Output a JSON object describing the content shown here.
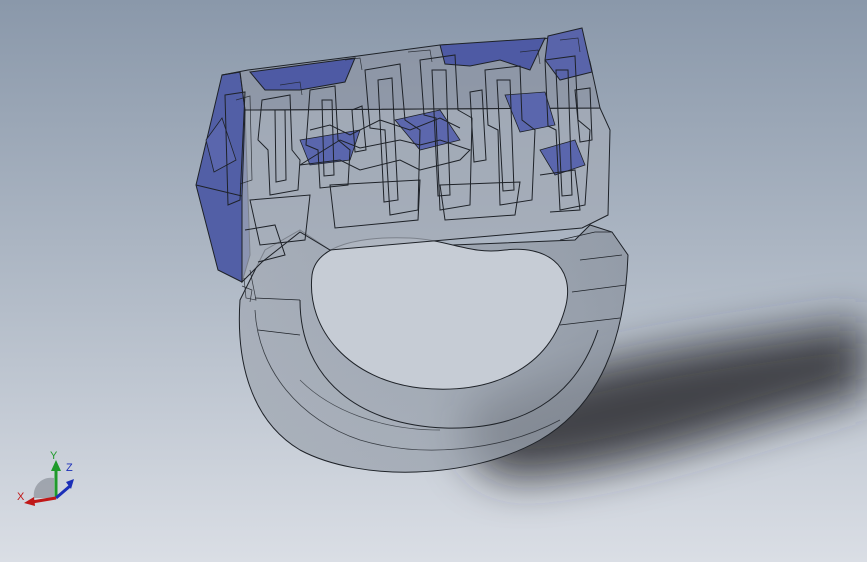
{
  "viewport": {
    "background_top": "#8c9aab",
    "background_bottom": "#d9dde4",
    "model_fill": "#9aa3b0",
    "model_edge": "#1e2228",
    "top_face_color": "#4f5ba3",
    "shadow_color": "#2a2c30"
  },
  "triad": {
    "x_label": "X",
    "y_label": "Y",
    "z_label": "Z",
    "x_color": "#c01818",
    "y_color": "#1f9a2b",
    "z_color": "#1b2fb8"
  }
}
